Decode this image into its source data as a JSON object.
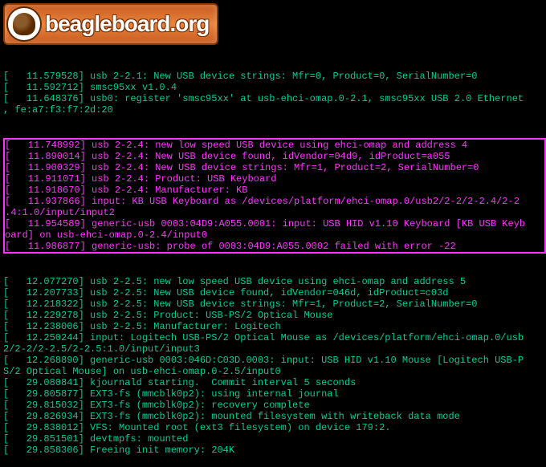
{
  "logo": {
    "text": "beagleboard.org"
  },
  "before": [
    "[   11.579528] usb 2-2.1: New USB device strings: Mfr=0, Product=0, SerialNumber=0",
    "[   11.592712] smsc95xx v1.0.4",
    "[   11.648376] usb0: register 'smsc95xx' at usb-ehci-omap.0-2.1, smsc95xx USB 2.0 Ethernet",
    ", fe:a7:f3:f7:2d:20"
  ],
  "highlight": [
    "[   11.748992] usb 2-2.4: new low speed USB device using ehci-omap and address 4",
    "[   11.890014] usb 2-2.4: New USB device found, idVendor=04d9, idProduct=a055",
    "[   11.900329] usb 2-2.4: New USB device strings: Mfr=1, Product=2, SerialNumber=0",
    "[   11.911071] usb 2-2.4: Product: USB Keyboard",
    "[   11.918670] usb 2-2.4: Manufacturer: KB",
    "[   11.937866] input: KB USB Keyboard as /devices/platform/ehci-omap.0/usb2/2-2/2-2.4/2-2",
    ".4:1.0/input/input2",
    "[   11.954589] generic-usb 0003:04D9:A055.0001: input: USB HID v1.10 Keyboard [KB USB Keyb",
    "oard] on usb-ehci-omap.0-2.4/input0",
    "[   11.986877] generic-usb: probe of 0003:04D9:A055.0002 failed with error -22"
  ],
  "after": [
    "[   12.077270] usb 2-2.5: new low speed USB device using ehci-omap and address 5",
    "[   12.207733] usb 2-2.5: New USB device found, idVendor=046d, idProduct=c03d",
    "[   12.218322] usb 2-2.5: New USB device strings: Mfr=1, Product=2, SerialNumber=0",
    "[   12.229278] usb 2-2.5: Product: USB-PS/2 Optical Mouse",
    "[   12.238006] usb 2-2.5: Manufacturer: Logitech",
    "[   12.250244] input: Logitech USB-PS/2 Optical Mouse as /devices/platform/ehci-omap.0/usb",
    "2/2-2/2-2.5/2-2.5:1.0/input/input3",
    "[   12.268890] generic-usb 0003:046D:C03D.0003: input: USB HID v1.10 Mouse [Logitech USB-P",
    "S/2 Optical Mouse] on usb-ehci-omap.0-2.5/input0",
    "[   29.080841] kjournald starting.  Commit interval 5 seconds",
    "[   29.805877] EXT3-fs (mmcblk0p2): using internal journal",
    "[   29.815032] EXT3-fs (mmcblk0p2): recovery complete",
    "[   29.826934] EXT3-fs (mmcblk0p2): mounted filesystem with writeback data mode",
    "[   29.838012] VFS: Mounted root (ext3 filesystem) on device 179:2.",
    "[   29.851501] devtmpfs: mounted",
    "[   29.858306] Freeing init memory: 204K"
  ]
}
